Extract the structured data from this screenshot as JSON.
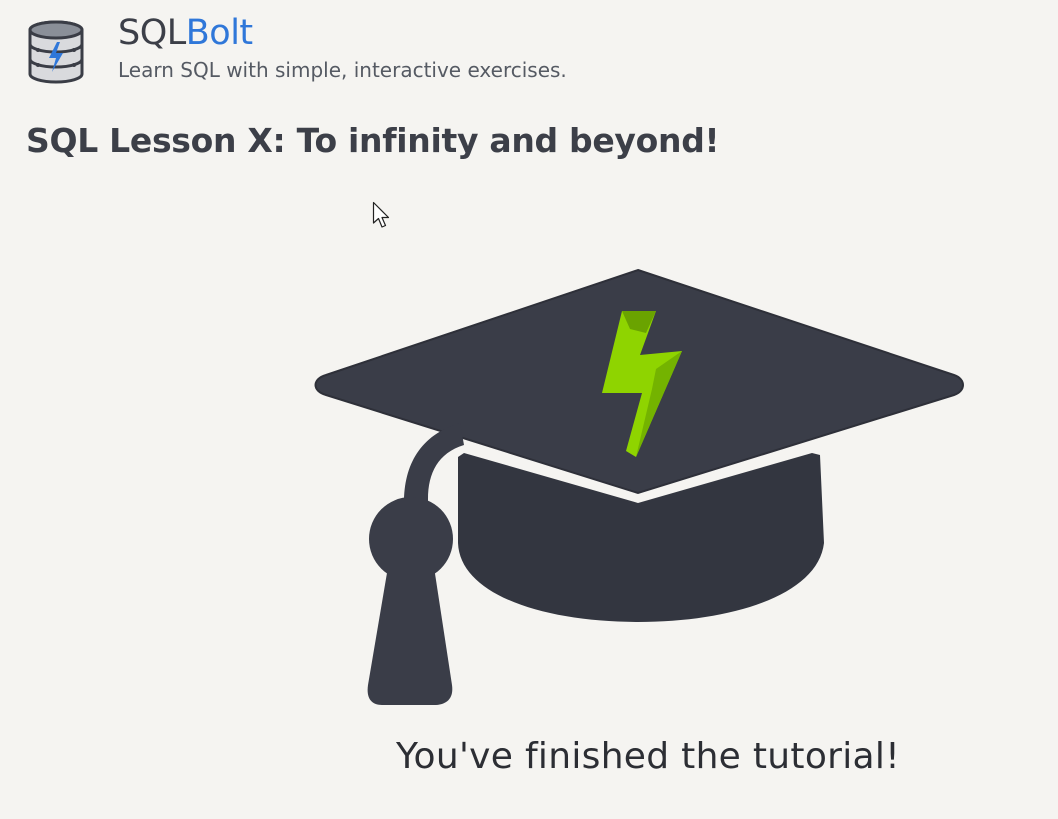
{
  "header": {
    "brand_prefix": "SQL",
    "brand_accent": "Bolt",
    "tagline": "Learn SQL with simple, interactive exercises."
  },
  "lesson": {
    "title": "SQL Lesson X: To infinity and beyond!",
    "completion_message": "You've finished the tutorial!"
  },
  "icons": {
    "logo": "database-bolt-icon",
    "illustration": "graduation-cap-bolt-icon",
    "pointer": "mouse-pointer-icon"
  },
  "colors": {
    "background": "#f5f4f1",
    "text": "#3c3f48",
    "accent": "#2f77d9",
    "cap": "#3a3d48",
    "bolt": "#8fd400"
  }
}
